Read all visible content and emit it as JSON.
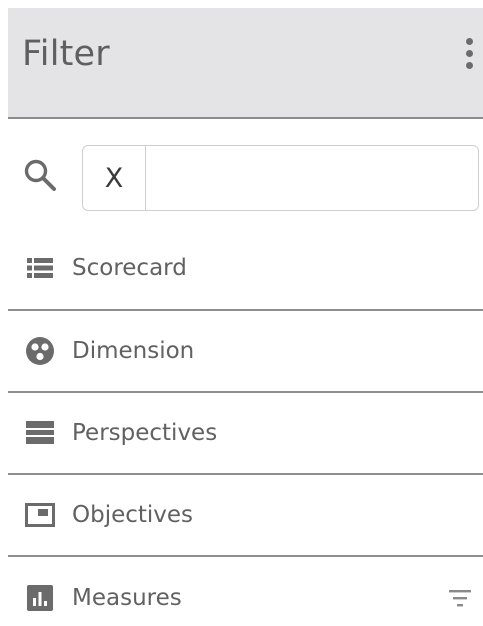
{
  "header": {
    "title": "Filter",
    "menu_icon": "kebab-menu-icon"
  },
  "search": {
    "icon": "search-icon",
    "clear_label": "X",
    "value": "",
    "placeholder": ""
  },
  "items": [
    {
      "label": "Scorecard",
      "icon": "scorecard-list-icon"
    },
    {
      "label": "Dimension",
      "icon": "dimension-circle-icon"
    },
    {
      "label": "Perspectives",
      "icon": "perspectives-stack-icon"
    },
    {
      "label": "Objectives",
      "icon": "objectives-window-icon"
    },
    {
      "label": "Measures",
      "icon": "measures-chart-icon",
      "trailing_icon": "filter-lines-icon"
    }
  ],
  "colors": {
    "header_bg": "#e4e3e6",
    "icon": "#6b6b6b",
    "text": "#616161",
    "divider": "#8e8e8e"
  }
}
